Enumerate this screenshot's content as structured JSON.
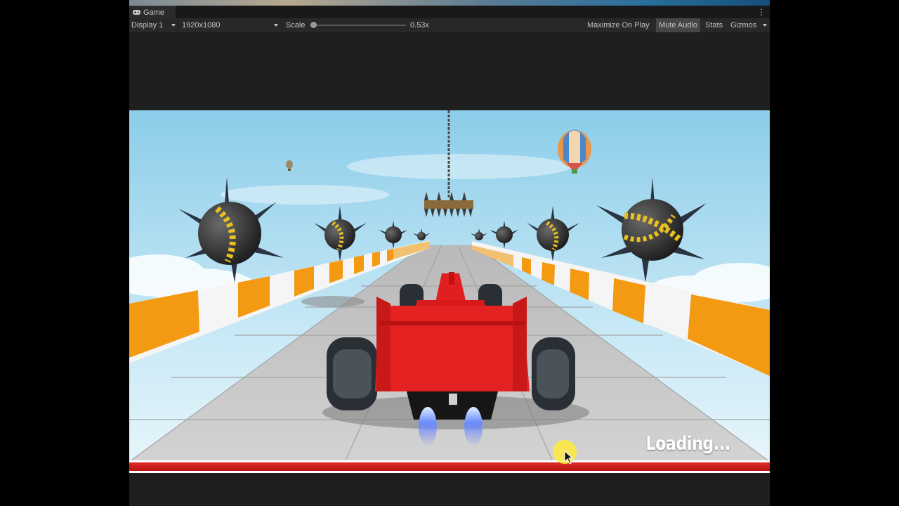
{
  "tab": {
    "label": "Game",
    "icon": "gamepad-icon"
  },
  "toolbar": {
    "display": "Display 1",
    "resolution": "1920x1080",
    "scale_label": "Scale",
    "scale_value": "0.53x",
    "scale_fraction": 0.03,
    "maximize": "Maximize On Play",
    "mute": "Mute Audio",
    "stats": "Stats",
    "gizmos": "Gizmos"
  },
  "game": {
    "loading_text": "Loading...",
    "progress": 1.0,
    "colors": {
      "car": "#e02020",
      "barrier_orange": "#f39a12",
      "sky": "#9fd4ee",
      "progress": "#d81e1e"
    }
  }
}
